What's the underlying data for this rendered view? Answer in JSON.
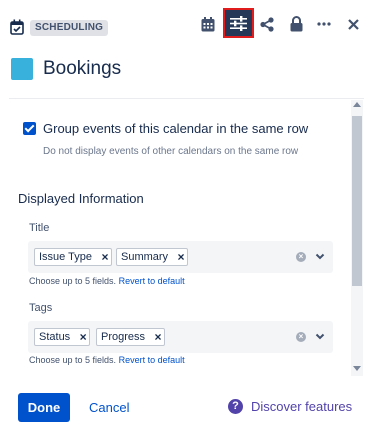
{
  "header": {
    "badge": "SCHEDULING"
  },
  "title": {
    "text": "Bookings",
    "swatch_color": "#38b1dc"
  },
  "options": {
    "group_row": {
      "label": "Group events of this calendar in the same row",
      "checked": true,
      "help": "Do not display events of other calendars on the same row"
    }
  },
  "displayed": {
    "heading": "Displayed Information",
    "title_field": {
      "label": "Title",
      "chips": [
        "Issue Type",
        "Summary"
      ],
      "help": "Choose up to 5 fields.",
      "link": "Revert to default"
    },
    "tags_field": {
      "label": "Tags",
      "chips": [
        "Status",
        "Progress"
      ],
      "help": "Choose up to 5 fields.",
      "link": "Revert to default"
    }
  },
  "footer": {
    "done": "Done",
    "cancel": "Cancel",
    "discover": "Discover features"
  },
  "icons": {
    "chip_remove": "×",
    "clear": "×",
    "help": "?"
  },
  "colors": {
    "primary": "#0052cc",
    "active_tool": "#253858",
    "highlight_border": "#e01c1c",
    "discover": "#5243aa"
  }
}
